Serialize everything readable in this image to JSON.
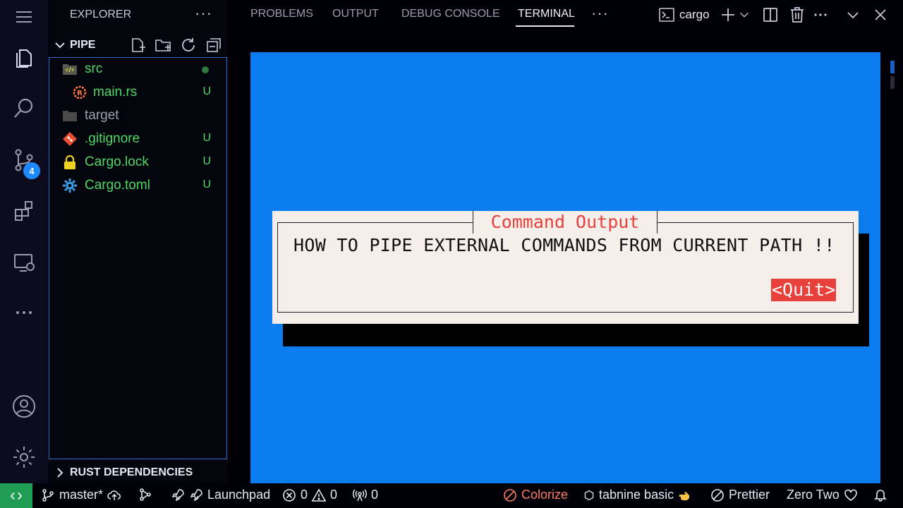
{
  "sidebar": {
    "header": "EXPLORER",
    "more": "···",
    "project": "PIPE",
    "files": [
      {
        "label": "src",
        "status": "",
        "color": "#4cd964",
        "icon": "folder-src-icon"
      },
      {
        "label": "main.rs",
        "status": "U",
        "color": "#4cd964",
        "icon": "rust-file-icon"
      },
      {
        "label": "target",
        "status": "",
        "color": "#a0a0b0",
        "icon": "folder-icon"
      },
      {
        "label": ".gitignore",
        "status": "U",
        "color": "#4cd964",
        "icon": "git-icon"
      },
      {
        "label": "Cargo.lock",
        "status": "U",
        "color": "#4cd964",
        "icon": "lock-icon"
      },
      {
        "label": "Cargo.toml",
        "status": "U",
        "color": "#4cd964",
        "icon": "gear-file-icon"
      }
    ],
    "rust_deps": "RUST DEPENDENCIES",
    "scm_badge": "4"
  },
  "panel": {
    "tabs": [
      "PROBLEMS",
      "OUTPUT",
      "DEBUG CONSOLE",
      "TERMINAL"
    ],
    "active_tab": "TERMINAL",
    "more": "···",
    "terminal_name": "cargo"
  },
  "dialog": {
    "title": "Command Output",
    "message": "HOW TO PIPE EXTERNAL COMMANDS FROM CURRENT PATH !!",
    "quit": "<Quit>"
  },
  "statusbar": {
    "branch": "master*",
    "launchpad": "Launchpad",
    "errors": "0",
    "warnings": "0",
    "ports": "0",
    "colorize": "Colorize",
    "tabnine": "tabnine basic",
    "prettier": "Prettier",
    "theme": "Zero Two"
  },
  "colors": {
    "accent": "#1d8bff",
    "terminal_bg": "#0b7cf0",
    "dialog_bg": "#f6eeea",
    "dialog_accent": "#e8403a",
    "untracked": "#4cd964",
    "remote_bg": "#1f9d55"
  }
}
